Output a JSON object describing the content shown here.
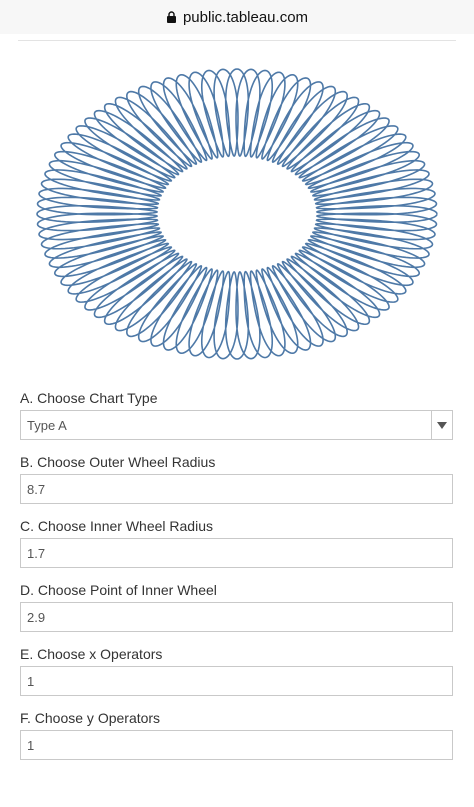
{
  "browser": {
    "url": "public.tableau.com"
  },
  "viz": {
    "color": "#4e79a7",
    "outer_radius": 8.7,
    "inner_radius": 1.7,
    "point": 2.9
  },
  "form": {
    "chart_type": {
      "label": "A. Choose Chart Type",
      "value": "Type A"
    },
    "outer_radius": {
      "label": "B. Choose Outer Wheel Radius",
      "value": "8.7"
    },
    "inner_radius": {
      "label": "C. Choose Inner Wheel Radius",
      "value": "1.7"
    },
    "inner_point": {
      "label": "D. Choose  Point of Inner Wheel",
      "value": "2.9"
    },
    "x_operators": {
      "label": "E. Choose x Operators",
      "value": "1"
    },
    "y_operators": {
      "label": "F. Choose y Operators",
      "value": "1"
    }
  }
}
